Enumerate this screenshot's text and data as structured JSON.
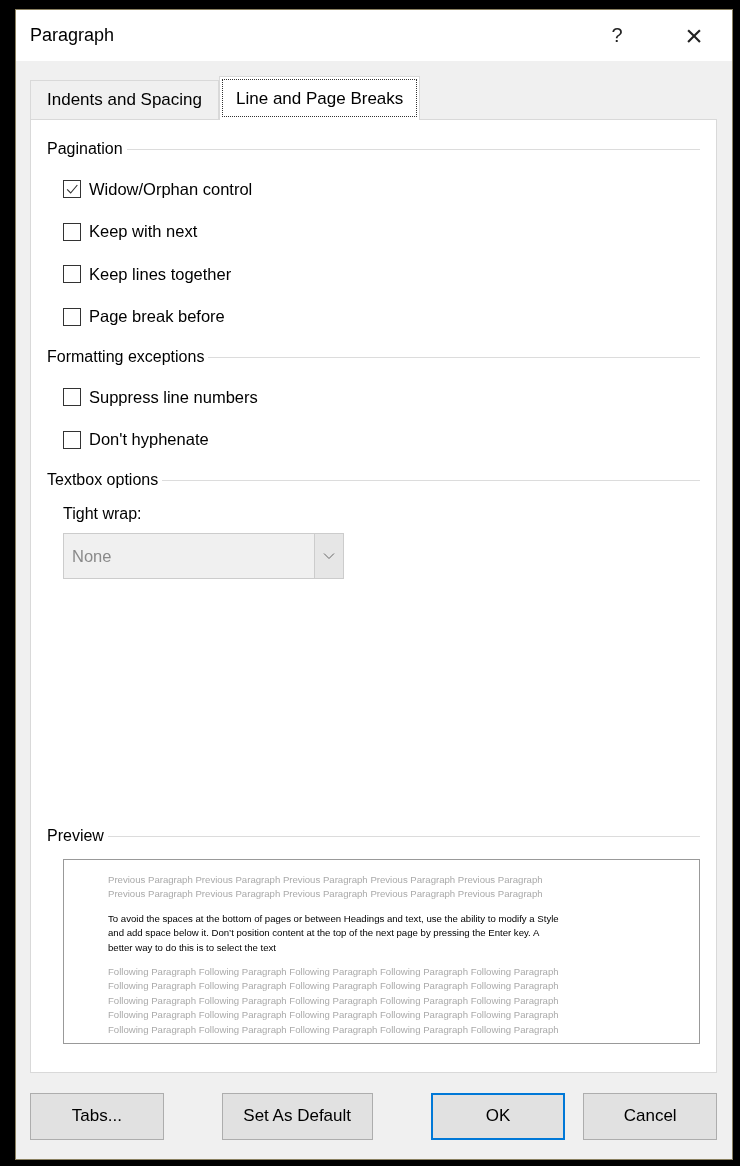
{
  "window": {
    "title": "Paragraph",
    "help": "?",
    "close": "×"
  },
  "tabs": [
    {
      "label": "Indents and Spacing",
      "selected": false
    },
    {
      "label": "Line and Page Breaks",
      "selected": true
    }
  ],
  "sections": [
    {
      "title": "Pagination",
      "items": [
        {
          "kind": "checkbox",
          "label": "Widow/Orphan control",
          "checked": true
        },
        {
          "kind": "checkbox",
          "label": "Keep with next",
          "checked": false
        },
        {
          "kind": "checkbox",
          "label": "Keep lines together",
          "checked": false
        },
        {
          "kind": "checkbox",
          "label": "Page break before",
          "checked": false
        }
      ]
    },
    {
      "title": "Formatting exceptions",
      "items": [
        {
          "kind": "checkbox",
          "label": "Suppress line numbers",
          "checked": false
        },
        {
          "kind": "checkbox",
          "label": "Don't hyphenate",
          "checked": false
        }
      ]
    },
    {
      "title": "Textbox options",
      "items": [
        {
          "kind": "dropdown",
          "label": "Tight wrap:",
          "value": "None",
          "disabled": true
        }
      ]
    }
  ],
  "preview": {
    "title": "Preview",
    "previous": [
      "Previous Paragraph Previous Paragraph Previous Paragraph Previous Paragraph Previous Paragraph",
      "Previous Paragraph Previous Paragraph Previous Paragraph Previous Paragraph Previous Paragraph"
    ],
    "sample": [
      "To avoid the spaces at the bottom of pages or between Headings and text, use the ability to modify a Style",
      "and add space below it. Don’t position content at the top of the next page by pressing the Enter key. A",
      "better way to do this is to select the text"
    ],
    "following": [
      "Following Paragraph Following Paragraph Following Paragraph Following Paragraph Following Paragraph",
      "Following Paragraph Following Paragraph Following Paragraph Following Paragraph Following Paragraph",
      "Following Paragraph Following Paragraph Following Paragraph Following Paragraph Following Paragraph",
      "Following Paragraph Following Paragraph Following Paragraph Following Paragraph Following Paragraph",
      "Following Paragraph Following Paragraph Following Paragraph Following Paragraph Following Paragraph"
    ]
  },
  "buttons": [
    {
      "label": "Tabs...",
      "default": false
    },
    {
      "label": "Set As Default",
      "default": false
    },
    {
      "label": "OK",
      "default": true
    },
    {
      "label": "Cancel",
      "default": false
    }
  ]
}
